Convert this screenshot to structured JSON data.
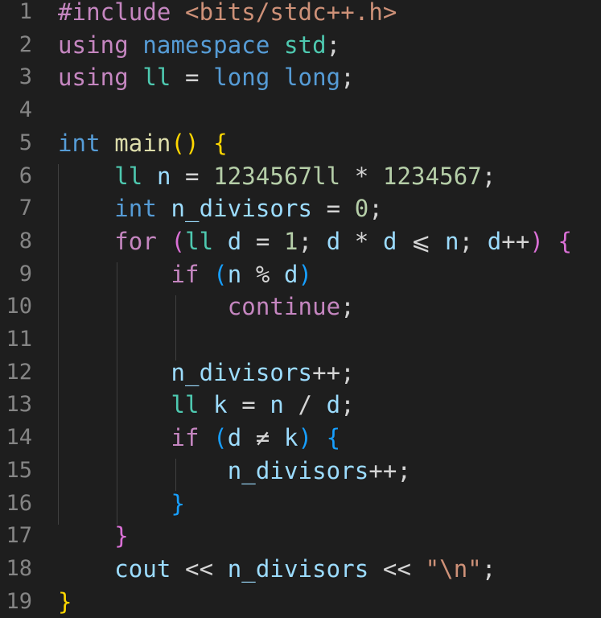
{
  "editor": {
    "lines": [
      {
        "number": "1",
        "tokens": [
          {
            "text": "#include ",
            "cls": "t-pre"
          },
          {
            "text": "<bits/stdc++.h>",
            "cls": "t-str"
          }
        ]
      },
      {
        "number": "2",
        "tokens": [
          {
            "text": "using",
            "cls": "t-kw"
          },
          {
            "text": " ",
            "cls": "t-pun"
          },
          {
            "text": "namespace",
            "cls": "t-type"
          },
          {
            "text": " ",
            "cls": "t-pun"
          },
          {
            "text": "std",
            "cls": "t-ns"
          },
          {
            "text": ";",
            "cls": "t-pun"
          }
        ]
      },
      {
        "number": "3",
        "tokens": [
          {
            "text": "using",
            "cls": "t-kw"
          },
          {
            "text": " ",
            "cls": "t-pun"
          },
          {
            "text": "ll",
            "cls": "t-tname"
          },
          {
            "text": " = ",
            "cls": "t-op"
          },
          {
            "text": "long long",
            "cls": "t-type"
          },
          {
            "text": ";",
            "cls": "t-pun"
          }
        ]
      },
      {
        "number": "4",
        "tokens": []
      },
      {
        "number": "5",
        "tokens": [
          {
            "text": "int",
            "cls": "t-type"
          },
          {
            "text": " ",
            "cls": "t-pun"
          },
          {
            "text": "main",
            "cls": "t-fn"
          },
          {
            "text": "()",
            "cls": "t-b1"
          },
          {
            "text": " ",
            "cls": "t-pun"
          },
          {
            "text": "{",
            "cls": "t-b1"
          }
        ]
      },
      {
        "number": "6",
        "tokens": [
          {
            "text": "    ",
            "cls": "t-pun"
          },
          {
            "text": "ll",
            "cls": "t-tname"
          },
          {
            "text": " ",
            "cls": "t-pun"
          },
          {
            "text": "n",
            "cls": "t-var"
          },
          {
            "text": " = ",
            "cls": "t-op"
          },
          {
            "text": "1234567ll",
            "cls": "t-num"
          },
          {
            "text": " * ",
            "cls": "t-op"
          },
          {
            "text": "1234567",
            "cls": "t-num"
          },
          {
            "text": ";",
            "cls": "t-pun"
          }
        ]
      },
      {
        "number": "7",
        "tokens": [
          {
            "text": "    ",
            "cls": "t-pun"
          },
          {
            "text": "int",
            "cls": "t-type"
          },
          {
            "text": " ",
            "cls": "t-pun"
          },
          {
            "text": "n_divisors",
            "cls": "t-var"
          },
          {
            "text": " = ",
            "cls": "t-op"
          },
          {
            "text": "0",
            "cls": "t-num"
          },
          {
            "text": ";",
            "cls": "t-pun"
          }
        ]
      },
      {
        "number": "8",
        "tokens": [
          {
            "text": "    ",
            "cls": "t-pun"
          },
          {
            "text": "for",
            "cls": "t-ctrl"
          },
          {
            "text": " ",
            "cls": "t-pun"
          },
          {
            "text": "(",
            "cls": "t-b2"
          },
          {
            "text": "ll",
            "cls": "t-tname"
          },
          {
            "text": " ",
            "cls": "t-pun"
          },
          {
            "text": "d",
            "cls": "t-var"
          },
          {
            "text": " = ",
            "cls": "t-op"
          },
          {
            "text": "1",
            "cls": "t-num"
          },
          {
            "text": "; ",
            "cls": "t-pun"
          },
          {
            "text": "d",
            "cls": "t-var"
          },
          {
            "text": " * ",
            "cls": "t-op"
          },
          {
            "text": "d",
            "cls": "t-var"
          },
          {
            "text": " ⩽ ",
            "cls": "t-op"
          },
          {
            "text": "n",
            "cls": "t-var"
          },
          {
            "text": "; ",
            "cls": "t-pun"
          },
          {
            "text": "d",
            "cls": "t-var"
          },
          {
            "text": "++",
            "cls": "t-op"
          },
          {
            "text": ")",
            "cls": "t-b2"
          },
          {
            "text": " ",
            "cls": "t-pun"
          },
          {
            "text": "{",
            "cls": "t-b2"
          }
        ]
      },
      {
        "number": "9",
        "tokens": [
          {
            "text": "        ",
            "cls": "t-pun"
          },
          {
            "text": "if",
            "cls": "t-ctrl"
          },
          {
            "text": " ",
            "cls": "t-pun"
          },
          {
            "text": "(",
            "cls": "t-b3"
          },
          {
            "text": "n",
            "cls": "t-var"
          },
          {
            "text": " % ",
            "cls": "t-op"
          },
          {
            "text": "d",
            "cls": "t-var"
          },
          {
            "text": ")",
            "cls": "t-b3"
          }
        ]
      },
      {
        "number": "10",
        "tokens": [
          {
            "text": "            ",
            "cls": "t-pun"
          },
          {
            "text": "continue",
            "cls": "t-ctrl"
          },
          {
            "text": ";",
            "cls": "t-pun"
          }
        ]
      },
      {
        "number": "11",
        "tokens": []
      },
      {
        "number": "12",
        "tokens": [
          {
            "text": "        ",
            "cls": "t-pun"
          },
          {
            "text": "n_divisors",
            "cls": "t-var"
          },
          {
            "text": "++",
            "cls": "t-op"
          },
          {
            "text": ";",
            "cls": "t-pun"
          }
        ]
      },
      {
        "number": "13",
        "tokens": [
          {
            "text": "        ",
            "cls": "t-pun"
          },
          {
            "text": "ll",
            "cls": "t-tname"
          },
          {
            "text": " ",
            "cls": "t-pun"
          },
          {
            "text": "k",
            "cls": "t-var"
          },
          {
            "text": " = ",
            "cls": "t-op"
          },
          {
            "text": "n",
            "cls": "t-var"
          },
          {
            "text": " / ",
            "cls": "t-op"
          },
          {
            "text": "d",
            "cls": "t-var"
          },
          {
            "text": ";",
            "cls": "t-pun"
          }
        ]
      },
      {
        "number": "14",
        "tokens": [
          {
            "text": "        ",
            "cls": "t-pun"
          },
          {
            "text": "if",
            "cls": "t-ctrl"
          },
          {
            "text": " ",
            "cls": "t-pun"
          },
          {
            "text": "(",
            "cls": "t-b3"
          },
          {
            "text": "d",
            "cls": "t-var"
          },
          {
            "text": " ≠ ",
            "cls": "t-op"
          },
          {
            "text": "k",
            "cls": "t-var"
          },
          {
            "text": ")",
            "cls": "t-b3"
          },
          {
            "text": " ",
            "cls": "t-pun"
          },
          {
            "text": "{",
            "cls": "t-b3"
          }
        ]
      },
      {
        "number": "15",
        "tokens": [
          {
            "text": "            ",
            "cls": "t-pun"
          },
          {
            "text": "n_divisors",
            "cls": "t-var"
          },
          {
            "text": "++",
            "cls": "t-op"
          },
          {
            "text": ";",
            "cls": "t-pun"
          }
        ]
      },
      {
        "number": "16",
        "tokens": [
          {
            "text": "        ",
            "cls": "t-pun"
          },
          {
            "text": "}",
            "cls": "t-b3"
          }
        ]
      },
      {
        "number": "17",
        "tokens": [
          {
            "text": "    ",
            "cls": "t-pun"
          },
          {
            "text": "}",
            "cls": "t-b2"
          }
        ]
      },
      {
        "number": "18",
        "tokens": [
          {
            "text": "    ",
            "cls": "t-pun"
          },
          {
            "text": "cout",
            "cls": "t-var"
          },
          {
            "text": " << ",
            "cls": "t-op"
          },
          {
            "text": "n_divisors",
            "cls": "t-var"
          },
          {
            "text": " << ",
            "cls": "t-op"
          },
          {
            "text": "\"\\n\"",
            "cls": "t-str"
          },
          {
            "text": ";",
            "cls": "t-pun"
          }
        ]
      },
      {
        "number": "19",
        "tokens": [
          {
            "text": "}",
            "cls": "t-b1"
          }
        ]
      }
    ]
  }
}
